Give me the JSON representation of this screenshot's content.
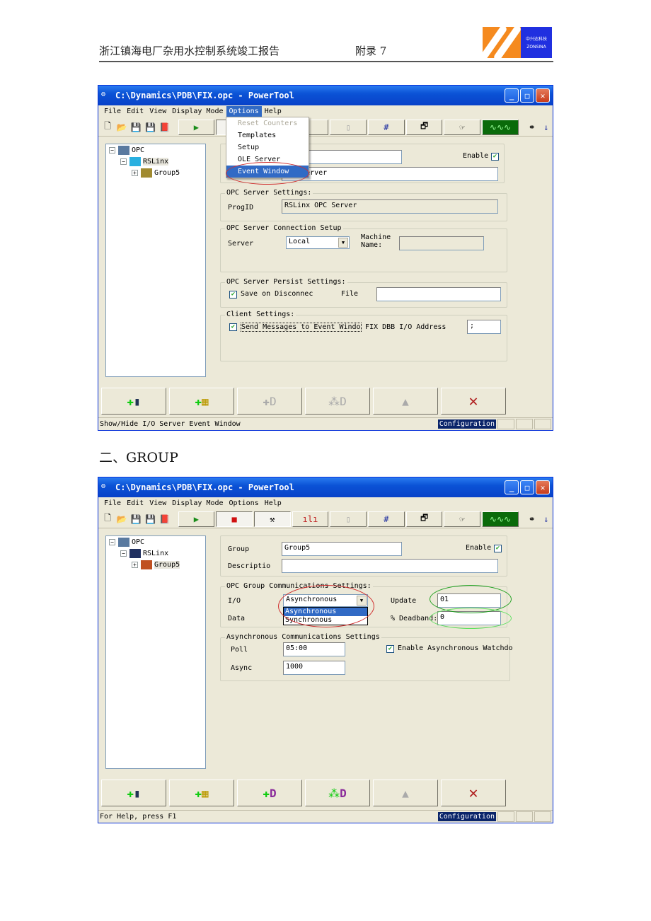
{
  "header": {
    "doc_title": "浙江镇海电厂杂用水控制系统竣工报告",
    "appendix": "附录 7",
    "logo_text_cn": "中兴达科技",
    "logo_text_en": "ZONSINA"
  },
  "section_heading": "二、GROUP",
  "window1": {
    "title": "C:\\Dynamics\\PDB\\FIX.opc - PowerTool",
    "menu": [
      "File",
      "Edit",
      "View",
      "Display Mode",
      "Options",
      "Help"
    ],
    "options_menu": [
      "Reset Counters",
      "Templates",
      "Setup",
      "OLE Server",
      "Event Window"
    ],
    "tree": [
      "OPC",
      "RSLinx",
      "Group5"
    ],
    "enable_label": "Enable",
    "description_value": "OPC Server",
    "server_settings": {
      "title": "OPC Server Settings:",
      "progid_label": "ProgID",
      "progid_value": "RSLinx OPC Server"
    },
    "connection": {
      "title": "OPC Server Connection Setup",
      "server_label": "Server",
      "server_value": "Local",
      "machine_label1": "Machine",
      "machine_label2": "Name:"
    },
    "persist": {
      "title": "OPC Server Persist Settings:",
      "save_label": "Save on Disconnec",
      "file_label": "File"
    },
    "client": {
      "title": "Client Settings:",
      "send_label": "Send Messages to Event Windo",
      "address_label": "FIX DBB I/O Address",
      "address_value": ";"
    },
    "status_text": "Show/Hide I/O Server Event Window",
    "status_mode": "Configuration"
  },
  "window2": {
    "title": "C:\\Dynamics\\PDB\\FIX.opc - PowerTool",
    "menu": [
      "File",
      "Edit",
      "View",
      "Display Mode",
      "Options",
      "Help"
    ],
    "tree": [
      "OPC",
      "RSLinx",
      "Group5"
    ],
    "group_label": "Group",
    "group_value": "Group5",
    "description_label": "Descriptio",
    "enable_label": "Enable",
    "comm": {
      "title": "OPC Group Communications Settings:",
      "io_label": "I/O",
      "io_value": "Asynchronous",
      "io_options": [
        "Asynchronous",
        "Synchronous"
      ],
      "data_label": "Data",
      "update_label": "Update",
      "update_value": "01",
      "deadband_label": "% Deadband:",
      "deadband_value": "0"
    },
    "async": {
      "title": "Asynchronous Communications Settings",
      "poll_label": "Poll",
      "poll_value": "05:00",
      "async_label": "Async",
      "async_value": "1000",
      "watchdog_label": "Enable Asynchronous Watchdo"
    },
    "status_text": "For Help, press F1",
    "status_mode": "Configuration"
  }
}
